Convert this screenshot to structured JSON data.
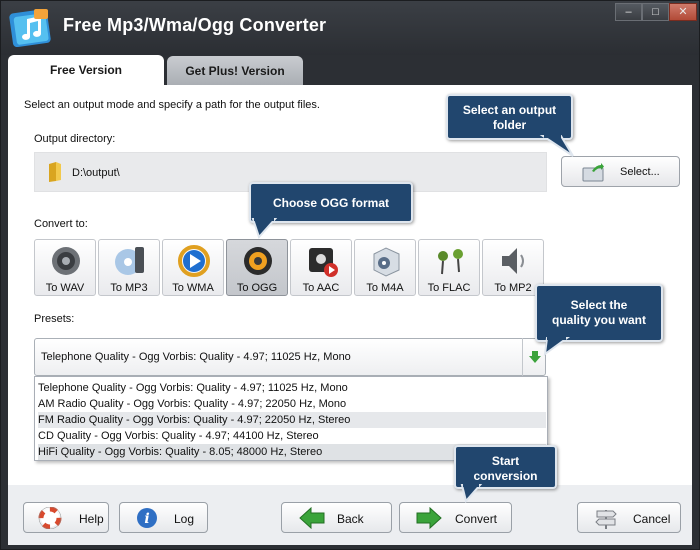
{
  "window": {
    "title": "Free Mp3/Wma/Ogg Converter",
    "minimize": "–",
    "maximize": "□",
    "close": "✕",
    "accent_color": "#2c2f34"
  },
  "tabs": [
    {
      "label": "Free Version",
      "active": true
    },
    {
      "label": "Get Plus! Version",
      "active": false
    }
  ],
  "main": {
    "intro": "Select an output mode and specify a path for the output files.",
    "output_label": "Output directory:",
    "output_path": "D:\\output\\",
    "select_button": "Select...",
    "convert_to_label": "Convert to:",
    "presets_label": "Presets:"
  },
  "formats": [
    {
      "label": "To WAV",
      "icon": "speaker-icon",
      "active": false
    },
    {
      "label": "To MP3",
      "icon": "cd-disc-icon",
      "active": false
    },
    {
      "label": "To WMA",
      "icon": "media-player-icon",
      "active": false
    },
    {
      "label": "To OGG",
      "icon": "orange-speaker-icon",
      "active": true
    },
    {
      "label": "To AAC",
      "icon": "apple-record-icon",
      "active": false
    },
    {
      "label": "To M4A",
      "icon": "box-icon",
      "active": false
    },
    {
      "label": "To FLAC",
      "icon": "headphones-icon",
      "active": false
    },
    {
      "label": "To MP2",
      "icon": "loudspeaker-icon",
      "active": false
    }
  ],
  "presets": {
    "selected": "Telephone Quality - Ogg Vorbis: Quality - 4.97; 11025 Hz, Mono",
    "options": [
      "Telephone Quality - Ogg Vorbis: Quality - 4.97; 11025 Hz, Mono",
      "AM Radio Quality - Ogg Vorbis: Quality - 4.97; 22050 Hz, Mono",
      "FM Radio Quality - Ogg Vorbis: Quality - 4.97; 22050 Hz, Stereo",
      "CD Quality - Ogg Vorbis: Quality - 4.97; 44100 Hz, Stereo",
      "HiFi Quality - Ogg Vorbis: Quality - 8.05; 48000 Hz, Stereo"
    ]
  },
  "bottom": {
    "help": "Help",
    "log": "Log",
    "back": "Back",
    "convert": "Convert",
    "cancel": "Cancel"
  },
  "callouts": {
    "output_folder_1": "Select an output",
    "output_folder_2": "folder",
    "ogg_format": "Choose OGG format",
    "quality_1": "Select the",
    "quality_2": "quality you want",
    "start_1": "Start",
    "start_2": "conversion"
  }
}
